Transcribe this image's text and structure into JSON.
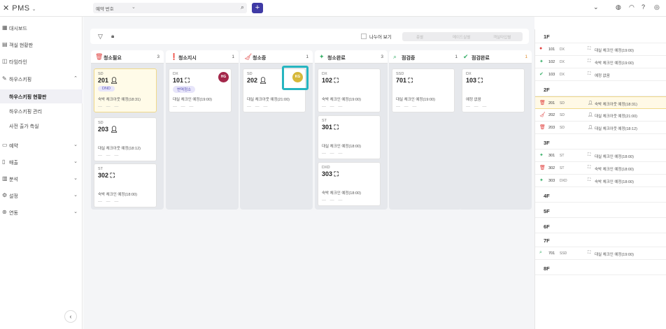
{
  "app": {
    "title": "PMS"
  },
  "search": {
    "placeholder": "예약 번호"
  },
  "sidebar": {
    "items": [
      {
        "label": "대시보드"
      },
      {
        "label": "객실 현황판"
      },
      {
        "label": "타임라인"
      },
      {
        "label": "하우스키핑"
      },
      {
        "label": "하우스키핑 현황판"
      },
      {
        "label": "하우스키핑 관리"
      },
      {
        "label": "사전 출가 측실"
      },
      {
        "label": "예약"
      },
      {
        "label": "매출"
      },
      {
        "label": "분석"
      },
      {
        "label": "설정"
      },
      {
        "label": "연동"
      }
    ]
  },
  "toolbar": {
    "split_label": "나누어 보기",
    "seg": [
      "층별",
      "메이드실별",
      "객실타입별"
    ]
  },
  "columns": [
    {
      "title": "청소필요",
      "count": "3",
      "color": "#e0413f",
      "cards": [
        {
          "type": "SD",
          "room": "201",
          "badge": "DND",
          "note": "숙박 체크아웃 예정(18:31)"
        },
        {
          "type": "SD",
          "room": "203",
          "note": "대실 체크아웃 예정(18:12)"
        },
        {
          "type": "ST",
          "room": "302",
          "note": "숙박 체크인 예정(18:00)"
        }
      ]
    },
    {
      "title": "청소지시",
      "count": "1",
      "color": "#e0413f",
      "cards": [
        {
          "type": "DX",
          "room": "101",
          "badge": "변역청소",
          "avatar": "HG",
          "note": "대실 체크인 예정(19:00)"
        }
      ]
    },
    {
      "title": "청소중",
      "count": "1",
      "color": "#e0413f",
      "cards": [
        {
          "type": "SD",
          "room": "202",
          "avatar": "KG",
          "note": "대실 체크아웃 예정(21:00)"
        }
      ]
    },
    {
      "title": "청소완료",
      "count": "3",
      "color": "#3ab06a",
      "cards": [
        {
          "type": "DX",
          "room": "102",
          "note": "숙박 체크인 예정(19:00)"
        },
        {
          "type": "ST",
          "room": "301",
          "note": "대실 체크인 예정(18:00)"
        },
        {
          "type": "DXD",
          "room": "303",
          "note": "숙박 체크인 예정(18:00)"
        }
      ]
    },
    {
      "title": "점검중",
      "count": "1",
      "color": "#3ab06a",
      "cards": [
        {
          "type": "SSD",
          "room": "701",
          "note": "대실 체크인 예정(19:00)"
        }
      ]
    },
    {
      "title": "점검완료",
      "count": "1",
      "color": "#3ab06a",
      "cards": [
        {
          "type": "DX",
          "room": "103",
          "note": "예정 없음"
        }
      ]
    }
  ],
  "floors": [
    {
      "label": "1F",
      "rooms": [
        {
          "room": "101",
          "type": "DX",
          "text": "대실 체크인 예정(19:00)"
        },
        {
          "room": "102",
          "type": "DX",
          "text": "숙박 체크인 예정(19:00)"
        },
        {
          "room": "103",
          "type": "DX",
          "text": "예정 없음"
        }
      ]
    },
    {
      "label": "2F",
      "rooms": [
        {
          "room": "201",
          "type": "SD",
          "text": "숙박 체크아웃 예정(18:31)"
        },
        {
          "room": "202",
          "type": "SD",
          "text": "대실 체크아웃 예정(21:00)"
        },
        {
          "room": "203",
          "type": "SD",
          "text": "대실 체크아웃 예정(18:12)"
        }
      ]
    },
    {
      "label": "3F",
      "rooms": [
        {
          "room": "301",
          "type": "ST",
          "text": "대실 체크인 예정(18:00)"
        },
        {
          "room": "302",
          "type": "ST",
          "text": "숙박 체크인 예정(18:00)"
        },
        {
          "room": "303",
          "type": "DXD",
          "text": "숙박 체크인 예정(18:00)"
        }
      ]
    },
    {
      "label": "4F",
      "rooms": []
    },
    {
      "label": "5F",
      "rooms": []
    },
    {
      "label": "6F",
      "rooms": []
    },
    {
      "label": "7F",
      "rooms": [
        {
          "room": "701",
          "type": "SSD",
          "text": "대실 체크인 예정(19:00)"
        }
      ]
    },
    {
      "label": "8F",
      "rooms": []
    }
  ]
}
